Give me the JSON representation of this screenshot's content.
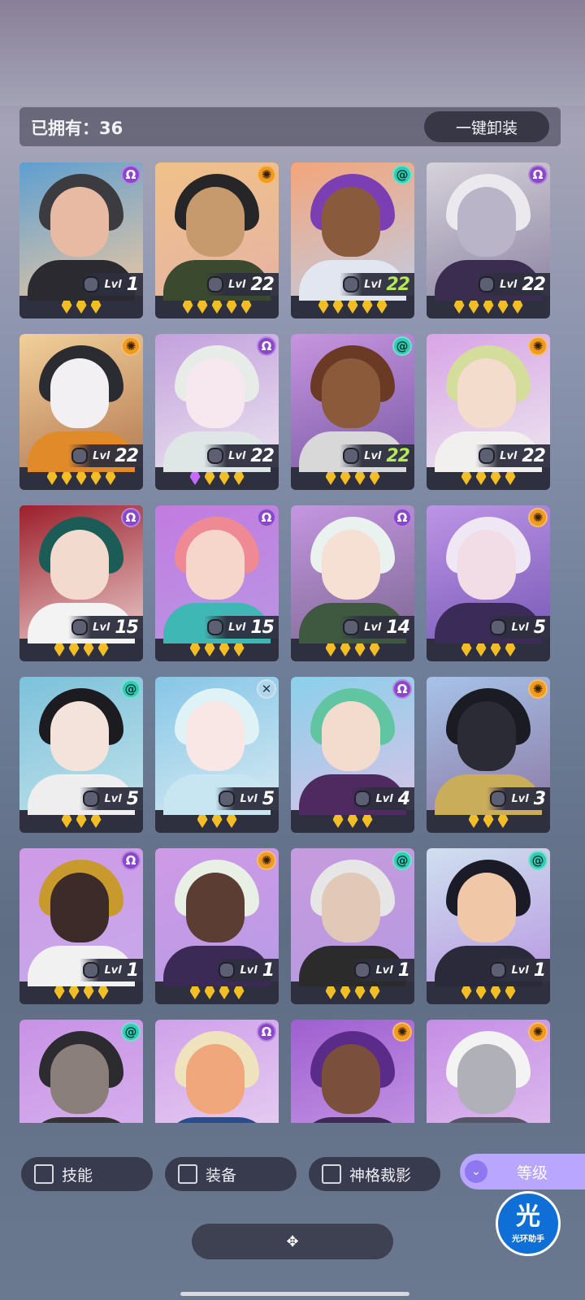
{
  "header": {
    "owned_label": "已拥有：36",
    "unequip_label": "一键卸装"
  },
  "factions": {
    "omega": {
      "glyph": "Ω",
      "bg": "#8a47c9",
      "color": "#ffffff"
    },
    "sun": {
      "glyph": "✺",
      "bg": "#f09a1e",
      "color": "#3a2000"
    },
    "spiral": {
      "glyph": "@",
      "bg": "#2fcdb4",
      "color": "#0c3a36"
    },
    "cross": {
      "glyph": "✕",
      "bg": "#b3d5ea",
      "color": "#1b3a55"
    }
  },
  "heroes": [
    {
      "level": "1",
      "stars": 3,
      "faction": "omega",
      "green": false,
      "bg": [
        "#5e9fd0",
        "#e9c6a2"
      ],
      "hair": "#3b3b40",
      "skin": "#e8b9a3",
      "cloth": "#2a2a30"
    },
    {
      "level": "22",
      "stars": 5,
      "faction": "sun",
      "green": false,
      "bg": [
        "#f0c188",
        "#e6b4a5"
      ],
      "hair": "#262628",
      "skin": "#c69a6d",
      "cloth": "#3b4a2f"
    },
    {
      "level": "22",
      "stars": 5,
      "faction": "spiral",
      "green": true,
      "bg": [
        "#f3a57a",
        "#c3cbe0"
      ],
      "hair": "#7b3fb3",
      "skin": "#8a5a3d",
      "cloth": "#e2e6f0"
    },
    {
      "level": "22",
      "stars": 5,
      "faction": "omega",
      "green": false,
      "bg": [
        "#d6d2da",
        "#8e86a4"
      ],
      "hair": "#ece9ee",
      "skin": "#b9b4c8",
      "cloth": "#3b2d4f"
    },
    {
      "level": "22",
      "stars": 5,
      "faction": "sun",
      "green": false,
      "bg": [
        "#f1d09a",
        "#b67b54"
      ],
      "hair": "#2b2b32",
      "skin": "#f3f0f4",
      "cloth": "#e08a2a"
    },
    {
      "level": "22",
      "stars": 4,
      "faction": "omega",
      "green": false,
      "purple_first": true,
      "bg": [
        "#c3a0dd",
        "#eae3ef"
      ],
      "hair": "#e8ece9",
      "skin": "#f6e8ee",
      "cloth": "#dfe6e6"
    },
    {
      "level": "22",
      "stars": 4,
      "faction": "spiral",
      "green": true,
      "bg": [
        "#c895e0",
        "#7b5ca7"
      ],
      "hair": "#6b3a24",
      "skin": "#8b5a3a",
      "cloth": "#d8d8d8"
    },
    {
      "level": "22",
      "stars": 4,
      "faction": "sun",
      "green": false,
      "bg": [
        "#d8a4e6",
        "#ece5ee"
      ],
      "hair": "#d4dd9b",
      "skin": "#f4dccd",
      "cloth": "#f2f0ee"
    },
    {
      "level": "15",
      "stars": 4,
      "faction": "omega",
      "green": false,
      "bg": [
        "#9c1f2b",
        "#e7c6c6"
      ],
      "hair": "#1c5c56",
      "skin": "#f2dacf",
      "cloth": "#f3f3f3"
    },
    {
      "level": "15",
      "stars": 4,
      "faction": "omega",
      "green": false,
      "bg": [
        "#c27be0",
        "#b996e3"
      ],
      "hair": "#ef8a94",
      "skin": "#f6d6cb",
      "cloth": "#3fb8b5"
    },
    {
      "level": "14",
      "stars": 4,
      "faction": "omega",
      "green": false,
      "bg": [
        "#c596e1",
        "#7f6a95"
      ],
      "hair": "#e9f2ef",
      "skin": "#f6e0d3",
      "cloth": "#3f5940"
    },
    {
      "level": "5",
      "stars": 4,
      "faction": "sun",
      "green": false,
      "bg": [
        "#bd94e6",
        "#7a5cb8"
      ],
      "hair": "#efe7f3",
      "skin": "#f2dce6",
      "cloth": "#3b2b59"
    },
    {
      "level": "5",
      "stars": 3,
      "faction": "spiral",
      "green": false,
      "bg": [
        "#7cc1db",
        "#bfe1ea"
      ],
      "hair": "#1b1b20",
      "skin": "#f3e3da",
      "cloth": "#eeeeee"
    },
    {
      "level": "5",
      "stars": 3,
      "faction": "cross",
      "green": false,
      "bg": [
        "#86c6e7",
        "#d4e9f2"
      ],
      "hair": "#dff2f6",
      "skin": "#f8e7e4",
      "cloth": "#c7e6f2"
    },
    {
      "level": "4",
      "stars": 3,
      "faction": "omega",
      "green": false,
      "bg": [
        "#8ad0ea",
        "#d7c3e8"
      ],
      "hair": "#62c5a2",
      "skin": "#f3dccd",
      "cloth": "#4e2a60"
    },
    {
      "level": "3",
      "stars": 3,
      "faction": "sun",
      "green": false,
      "bg": [
        "#a7c3e8",
        "#8d7da8"
      ],
      "hair": "#1b1b24",
      "skin": "#2b2b35",
      "cloth": "#c9ad5a"
    },
    {
      "level": "1",
      "stars": 4,
      "faction": "omega",
      "green": false,
      "bg": [
        "#cf9ae6",
        "#c7a9ea"
      ],
      "hair": "#c89a2d",
      "skin": "#3d2b2a",
      "cloth": "#f1f1f1"
    },
    {
      "level": "1",
      "stars": 4,
      "faction": "sun",
      "green": false,
      "bg": [
        "#cf9ae6",
        "#b89be6"
      ],
      "hair": "#e8efe5",
      "skin": "#5b3d34",
      "cloth": "#3a2a55"
    },
    {
      "level": "1",
      "stars": 4,
      "faction": "spiral",
      "green": false,
      "bg": [
        "#c79bde",
        "#b69ae0"
      ],
      "hair": "#e6e6e6",
      "skin": "#e2c8b6",
      "cloth": "#2b2b2b"
    },
    {
      "level": "1",
      "stars": 4,
      "faction": "spiral",
      "green": false,
      "bg": [
        "#cfe0ef",
        "#b89ae2"
      ],
      "hair": "#1b1b27",
      "skin": "#f0c8a8",
      "cloth": "#2a2a3a"
    },
    {
      "level": "",
      "stars": 0,
      "faction": "spiral",
      "green": false,
      "bg": [
        "#c892e6",
        "#d9b4ee"
      ],
      "hair": "#2b2b30",
      "skin": "#8b7f7c",
      "cloth": "#333333"
    },
    {
      "level": "",
      "stars": 0,
      "faction": "omega",
      "green": false,
      "bg": [
        "#d0a1ea",
        "#e8d2f1"
      ],
      "hair": "#efe3bd",
      "skin": "#f0a77c",
      "cloth": "#2b4c8a"
    },
    {
      "level": "",
      "stars": 0,
      "faction": "sun",
      "green": false,
      "bg": [
        "#9f5fd0",
        "#c79be6"
      ],
      "hair": "#5b2b8a",
      "skin": "#7a4f3b",
      "cloth": "#3b2b55"
    },
    {
      "level": "",
      "stars": 0,
      "faction": "sun",
      "green": false,
      "bg": [
        "#c58ee6",
        "#e0c0ee"
      ],
      "hair": "#f3f3f3",
      "skin": "#b0b0b8",
      "cloth": "#555566"
    }
  ],
  "lvl_prefix": "Lvl",
  "filters": {
    "skill": "技能",
    "equipment": "装备",
    "divinity": "神格裁影",
    "sort": "等级"
  },
  "assistant": {
    "big": "光",
    "small": "光环助手"
  },
  "expand_icon": "✥"
}
